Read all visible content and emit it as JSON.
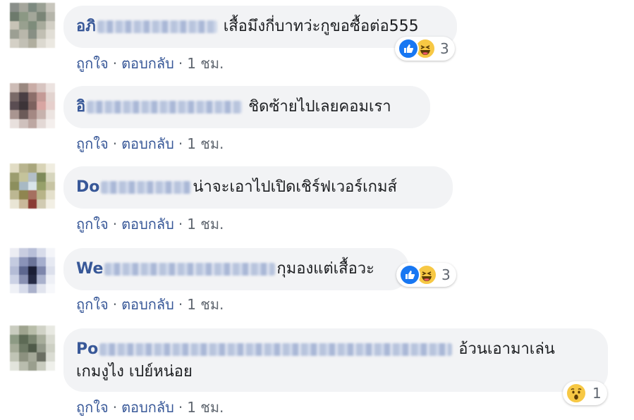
{
  "actions": {
    "like": "ถูกใจ",
    "reply": "ตอบกลับ",
    "time": "1 ชม."
  },
  "colors": {
    "link": "#385898",
    "bubble": "#f2f3f5",
    "like_blue": "#1877f2",
    "emoji_yellow": "#f7c844"
  },
  "comments": [
    {
      "author": "อภิ",
      "text": "เสื้อมึงกี่บาทว่ะกูขอซื้อต่อ555",
      "reactions": [
        "like-icon",
        "haha-icon"
      ],
      "reaction_count": "3"
    },
    {
      "author": "อิ",
      "text": "ชิดซ้ายไปเลยคอมเรา",
      "reactions": [],
      "reaction_count": ""
    },
    {
      "author": "Do",
      "text": "น่าจะเอาไปเปิดเชิร์ฟเวอร์เกมส์",
      "reactions": [],
      "reaction_count": ""
    },
    {
      "author": "We",
      "text": "กุมองแต่เสื้อวะ",
      "reactions": [
        "like-icon",
        "haha-icon"
      ],
      "reaction_count": "3"
    },
    {
      "author": "Po",
      "text": "อ้วนเอามาเล่น",
      "text_line2": "เกมงูไง เปย์หน่อย",
      "reactions": [
        "wow-icon"
      ],
      "reaction_count": "1"
    }
  ]
}
